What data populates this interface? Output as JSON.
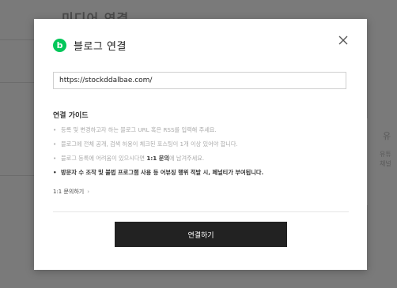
{
  "background": {
    "page_title": "미디어 연결",
    "right_heading": "유",
    "right_text": "유튜\n채널"
  },
  "modal": {
    "logo_letter": "b",
    "title": "블로그 연결",
    "url_input": {
      "value": "https://stockddalbae.com/",
      "placeholder": ""
    },
    "guide": {
      "title": "연결 가이드",
      "items": [
        {
          "text": "등록 및 변경하고자 하는 블로그 URL 혹은 RSS를 입력해 주세요."
        },
        {
          "text": "블로그에 전체 공개, 검색 허용이 체크된 포스팅이 1개 이상 있어야 합니다."
        },
        {
          "before": "블로그 등록에 어려움이 있으시다면 ",
          "em": "1:1 문의",
          "after": "에 남겨주세요."
        },
        {
          "text": "방문자 수 조작 및 불법 프로그램 사용 등 어뷰징 행위 적발 시, 페널티가 부여됩니다."
        }
      ]
    },
    "inquiry_link": "1:1 문의하기",
    "connect_button": "연결하기",
    "colors": {
      "logo": "#03c75a",
      "button": "#222222"
    }
  }
}
